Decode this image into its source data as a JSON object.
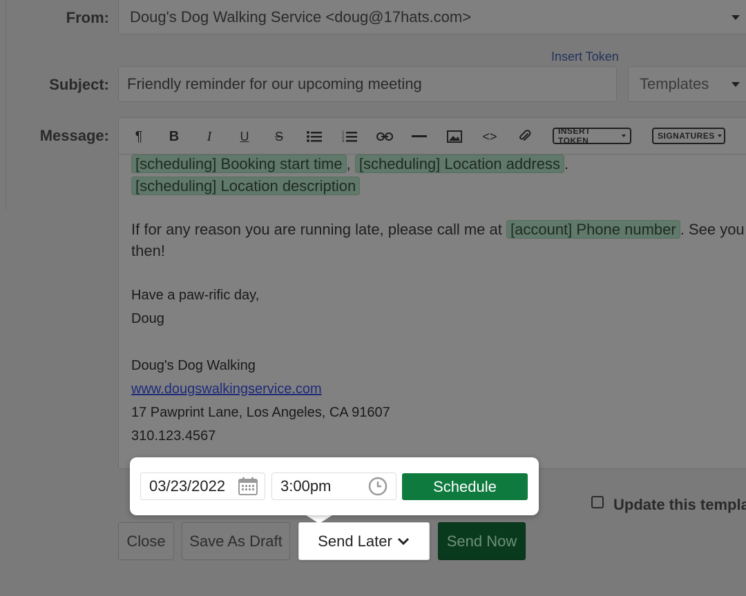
{
  "form": {
    "from_label": "From:",
    "from_value": "Doug's Dog Walking Service <doug@17hats.com>",
    "insert_token_link": "Insert Token",
    "subject_label": "Subject:",
    "subject_value": "Friendly reminder for our upcoming meeting",
    "templates_placeholder": "Templates",
    "message_label": "Message:"
  },
  "toolbar": {
    "icons": [
      "paragraph-icon",
      "bold-icon",
      "italic-icon",
      "underline-icon",
      "strikethrough-icon",
      "bullet-list-icon",
      "numbered-list-icon",
      "link-icon",
      "horizontal-rule-icon",
      "image-icon",
      "code-icon",
      "attachment-icon"
    ],
    "insert_token_label": "INSERT TOKEN",
    "signatures_label": "SIGNATURES"
  },
  "message": {
    "token_booking_start": "[scheduling] Booking start time",
    "comma": ",",
    "token_location_address": "[scheduling] Location address",
    "period": ".",
    "token_location_description": "[scheduling] Location description",
    "late_text": "If for any reason you are running late, please call me at",
    "token_phone": "[account] Phone number",
    "see_you": ". See you",
    "then": "then!",
    "greeting": "Have a paw-rific day,",
    "name": "Doug",
    "sig_business": "Doug's Dog Walking",
    "sig_website": "www.dougswalkingservice.com",
    "sig_address": "17 Pawprint Lane, Los Angeles, CA 91607",
    "sig_phone": "310.123.4567"
  },
  "update_template_label": "Update this template",
  "schedule_popover": {
    "date_value": "03/23/2022",
    "time_value": "3:00pm",
    "schedule_button": "Schedule"
  },
  "actions": {
    "close": "Close",
    "save_draft": "Save As Draft",
    "send_later": "Send Later",
    "send_now": "Send Now"
  },
  "colors": {
    "primary_green": "#0f7a3e",
    "send_now_dim": "#0a3a1e",
    "token_bg": "#60796a",
    "overlay": "#7a7a7a"
  }
}
